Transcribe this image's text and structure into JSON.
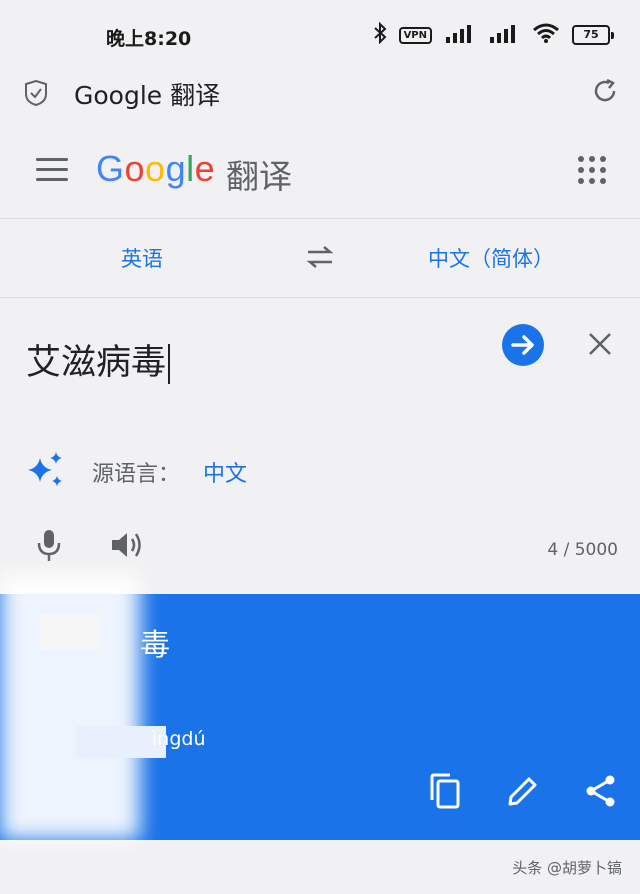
{
  "status_bar": {
    "time": "晚上8:20",
    "vpn": "VPN",
    "battery": "75"
  },
  "browser": {
    "title": "Google 翻译"
  },
  "header": {
    "logo": [
      "G",
      "o",
      "o",
      "g",
      "l",
      "e"
    ],
    "logo_colors": [
      "#4285F4",
      "#EA4335",
      "#FBBC05",
      "#4285F4",
      "#34A853",
      "#EA4335"
    ],
    "suffix": "翻译"
  },
  "languages": {
    "source": "英语",
    "target": "中文（简体）"
  },
  "input": {
    "text": "艾滋病毒",
    "detected_label": "源语言：",
    "detected_value": "中文",
    "char_count": "4 / 5000"
  },
  "result": {
    "translation": "毒",
    "pinyin": "ìngdú"
  },
  "watermark": "头条 @胡萝卜镐",
  "colors": {
    "accent": "#1a73e8",
    "background": "#f1f1f3"
  }
}
